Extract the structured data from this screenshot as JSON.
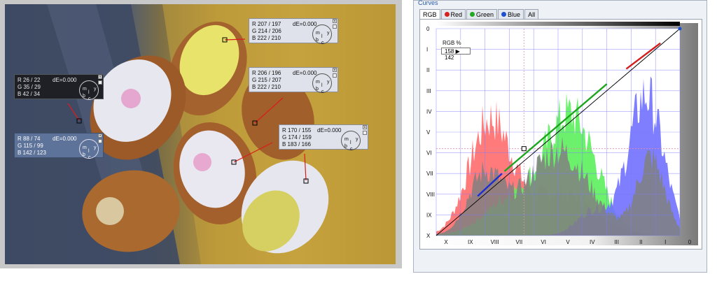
{
  "curves_panel": {
    "title": "Curves",
    "tabs": [
      {
        "label": "RGB",
        "color": ""
      },
      {
        "label": "Red",
        "color": "#d62020"
      },
      {
        "label": "Green",
        "color": "#22a822"
      },
      {
        "label": "Blue",
        "color": "#2050d0"
      },
      {
        "label": "All",
        "color": ""
      }
    ],
    "readout_label": "RGB %",
    "readout_value": "158 ▶ 142",
    "y_zones": [
      "0",
      "I",
      "II",
      "III",
      "IV",
      "V",
      "VI",
      "VII",
      "VIII",
      "IX",
      "X"
    ],
    "x_zones": [
      "X",
      "IX",
      "VIII",
      "VII",
      "VI",
      "V",
      "IV",
      "III",
      "II",
      "I",
      "0"
    ],
    "colors": {
      "red_hist": "#ff6b6b",
      "green_hist": "#5cf05c",
      "blue_hist": "#7070ff",
      "gray_hist": "#808080",
      "grid": "#7a7aff"
    }
  },
  "samples": [
    {
      "id": "s1",
      "style": "light",
      "r": "R 207 / 197",
      "g": "G 214 / 206",
      "b": "B 222 / 210",
      "de": "dE=0.000"
    },
    {
      "id": "s2",
      "style": "light",
      "r": "R 206 / 196",
      "g": "G 215 / 207",
      "b": "B 222 / 210",
      "de": "dE=0.000"
    },
    {
      "id": "s3",
      "style": "dark",
      "r": "R  26 /  22",
      "g": "G  35 /  29",
      "b": "B  42 /  34",
      "de": "dE=0.000"
    },
    {
      "id": "s4",
      "style": "light",
      "r": "R 170 / 155",
      "g": "G 174 / 159",
      "b": "B 183 / 166",
      "de": "dE=0.000"
    },
    {
      "id": "s5",
      "style": "blue",
      "r": "R  88 /  74",
      "g": "G 115 /  99",
      "b": "B 142 / 123",
      "de": "dE=0.000"
    }
  ],
  "dial_labels": {
    "m": "m",
    "y": "y",
    "c": "c",
    "b": "b",
    "l": "l"
  }
}
